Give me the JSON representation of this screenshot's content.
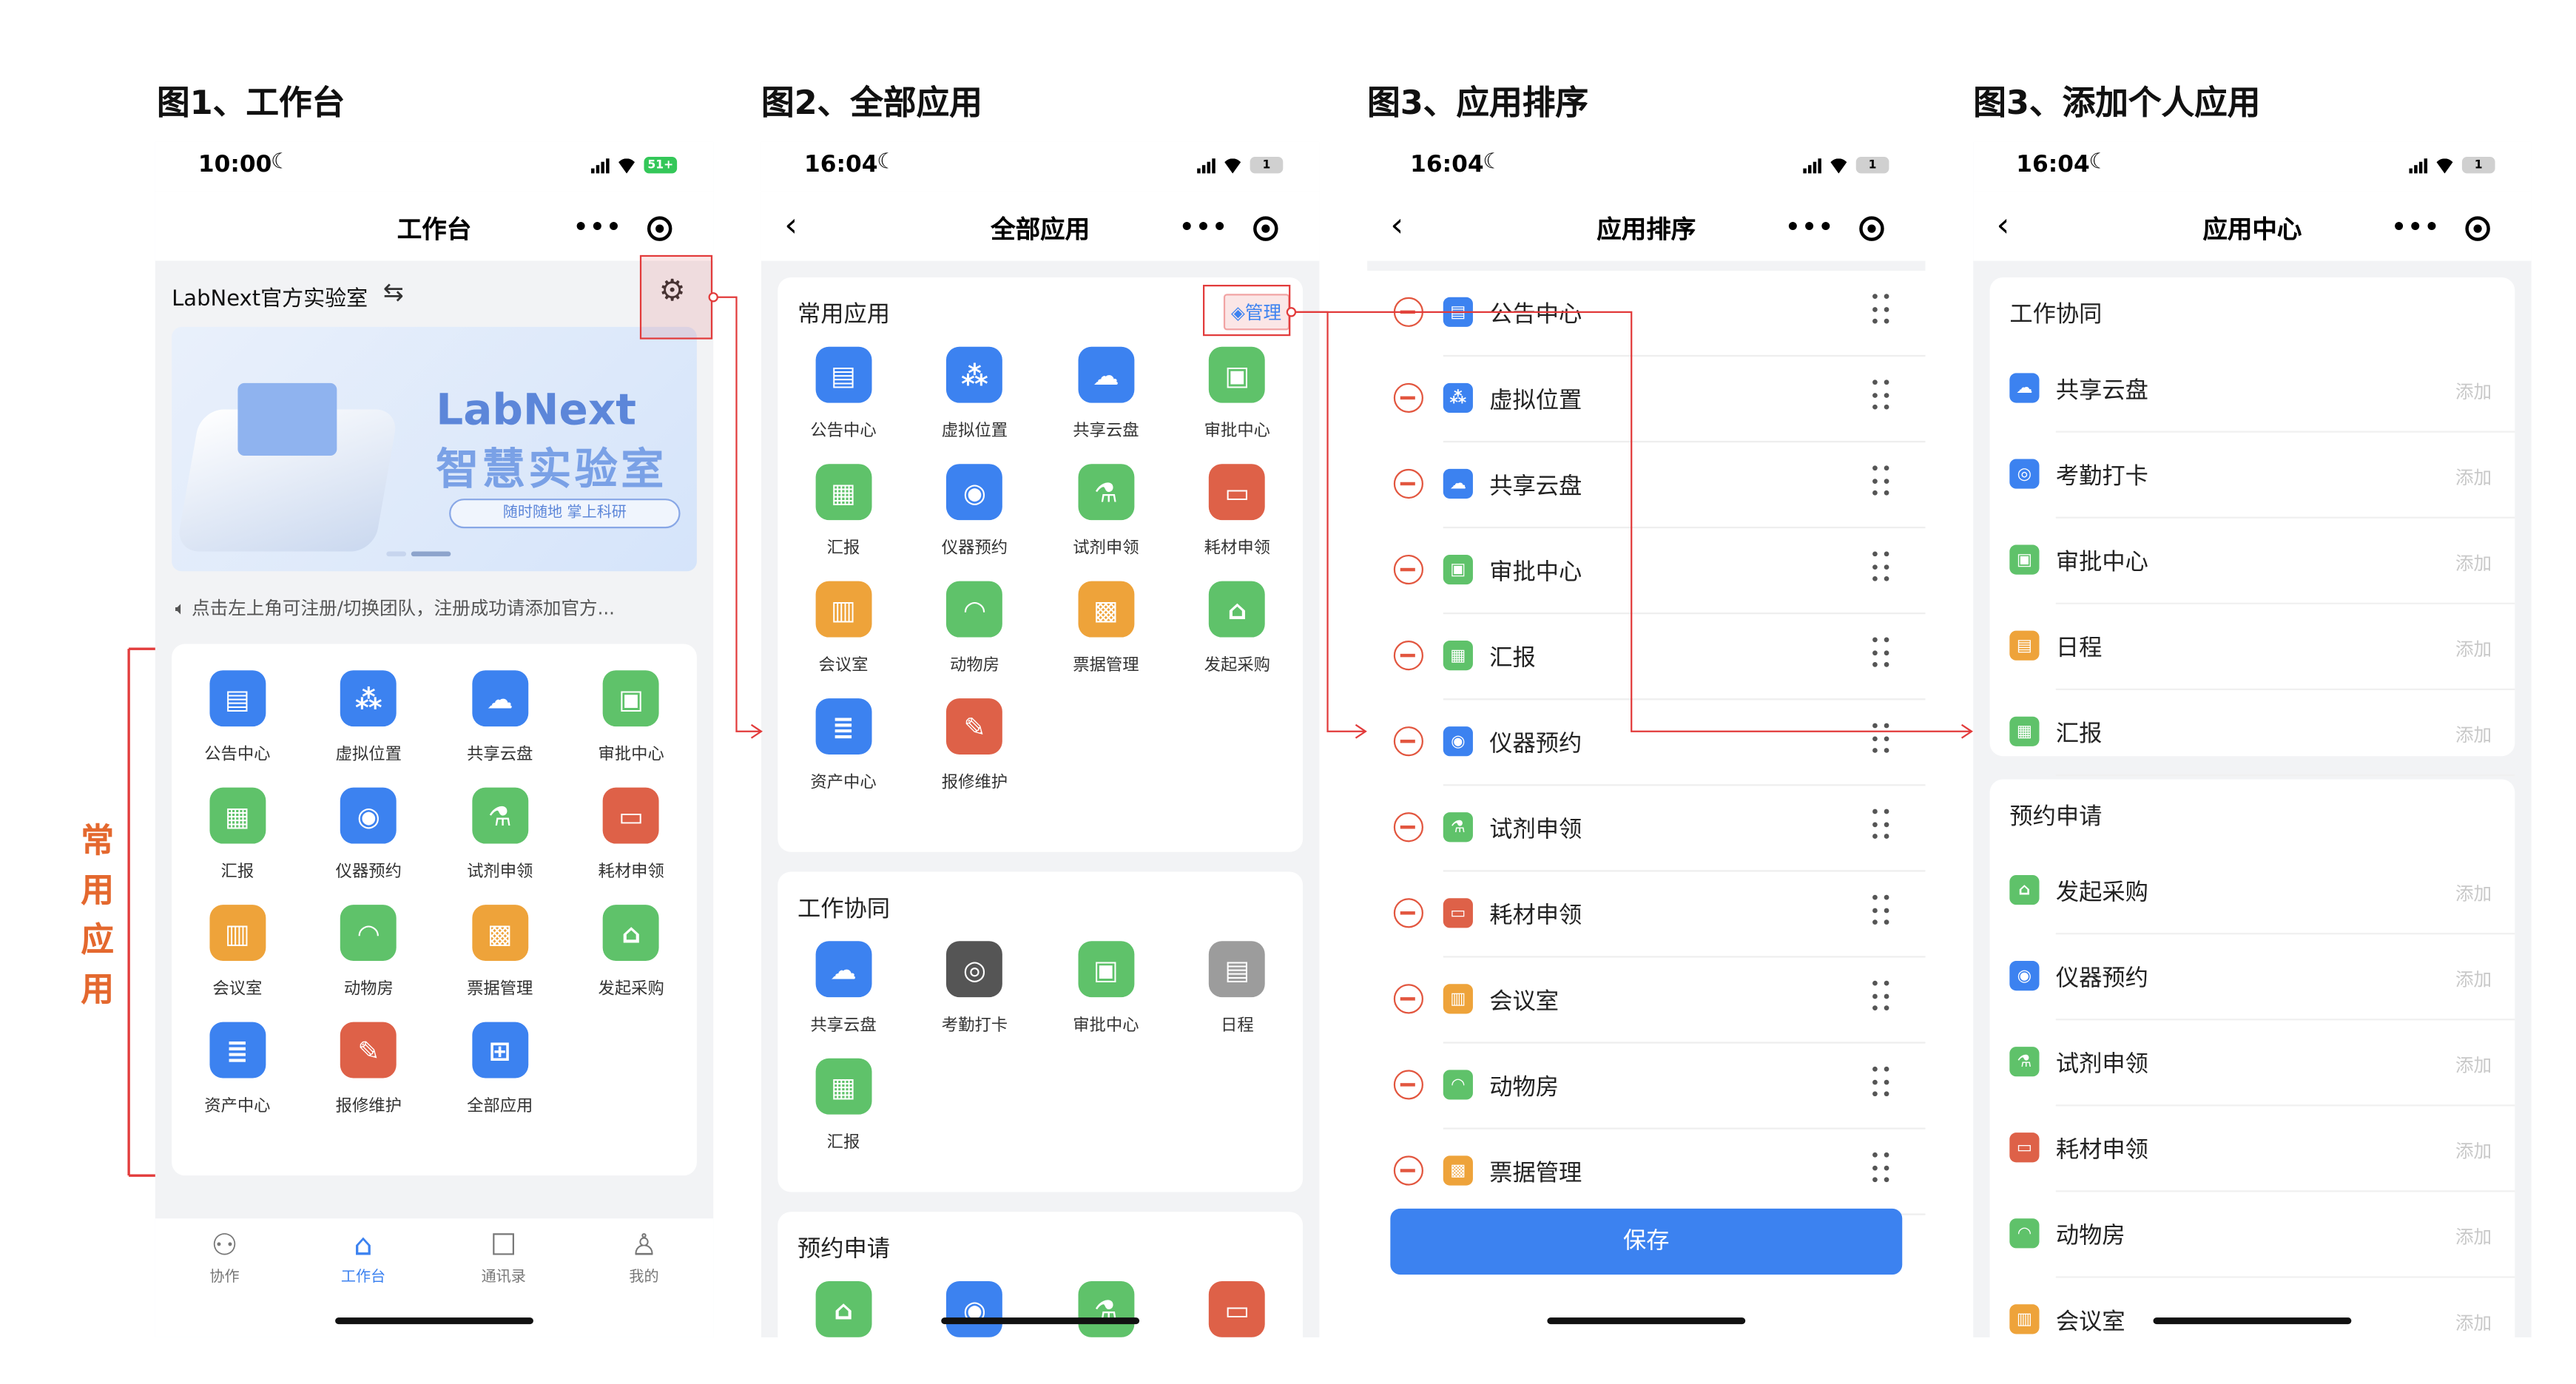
{
  "figures": [
    {
      "title": "图1、工作台",
      "time": "10:00",
      "battery": "51+",
      "nav_title": "工作台",
      "team": "LabNext官方实验室",
      "switch_icon": "swap-icon",
      "settings_icon": "gear-icon",
      "banner": {
        "line1": "LabNext",
        "line2": "智慧实验室",
        "line3": "随时随地  掌上科研"
      },
      "notice": "点击左上角可注册/切换团队，注册成功请添加官方...",
      "side_label": "常用应用",
      "apps": [
        {
          "label": "公告中心",
          "icon": "clipboard-icon",
          "color": "#3c82f0"
        },
        {
          "label": "虚拟位置",
          "icon": "cubes-icon",
          "color": "#3c82f0"
        },
        {
          "label": "共享云盘",
          "icon": "cloud-icon",
          "color": "#3c82f0"
        },
        {
          "label": "审批中心",
          "icon": "approval-icon",
          "color": "#5fc26a"
        },
        {
          "label": "汇报",
          "icon": "calendar-icon",
          "color": "#5fc26a"
        },
        {
          "label": "仪器预约",
          "icon": "instrument-icon",
          "color": "#3c82f0"
        },
        {
          "label": "试剂申领",
          "icon": "flask-icon",
          "color": "#5fc26a"
        },
        {
          "label": "耗材申领",
          "icon": "box-icon",
          "color": "#de6148"
        },
        {
          "label": "会议室",
          "icon": "meeting-icon",
          "color": "#eea33a"
        },
        {
          "label": "动物房",
          "icon": "animal-icon",
          "color": "#5fc26a"
        },
        {
          "label": "票据管理",
          "icon": "ticket-icon",
          "color": "#eea33a"
        },
        {
          "label": "发起采购",
          "icon": "store-icon",
          "color": "#5fc26a"
        },
        {
          "label": "资产中心",
          "icon": "database-icon",
          "color": "#3c82f0"
        },
        {
          "label": "报修维护",
          "icon": "repair-icon",
          "color": "#de6148"
        },
        {
          "label": "全部应用",
          "icon": "grid-plus-icon",
          "color": "#3c82f0"
        }
      ],
      "tabs": [
        {
          "label": "协作",
          "icon": "people-icon"
        },
        {
          "label": "工作台",
          "icon": "desk-icon"
        },
        {
          "label": "通讯录",
          "icon": "contacts-icon"
        },
        {
          "label": "我的",
          "icon": "user-icon"
        }
      ]
    },
    {
      "title": "图2、全部应用",
      "time": "16:04",
      "battery": "1",
      "nav_title": "全部应用",
      "sections": [
        {
          "title": "常用应用",
          "manage": "管理",
          "apps": [
            {
              "label": "公告中心",
              "icon": "clipboard-icon",
              "color": "#3c82f0"
            },
            {
              "label": "虚拟位置",
              "icon": "cubes-icon",
              "color": "#3c82f0"
            },
            {
              "label": "共享云盘",
              "icon": "cloud-icon",
              "color": "#3c82f0"
            },
            {
              "label": "审批中心",
              "icon": "approval-icon",
              "color": "#5fc26a"
            },
            {
              "label": "汇报",
              "icon": "calendar-icon",
              "color": "#5fc26a"
            },
            {
              "label": "仪器预约",
              "icon": "instrument-icon",
              "color": "#3c82f0"
            },
            {
              "label": "试剂申领",
              "icon": "flask-icon",
              "color": "#5fc26a"
            },
            {
              "label": "耗材申领",
              "icon": "box-icon",
              "color": "#de6148"
            },
            {
              "label": "会议室",
              "icon": "meeting-icon",
              "color": "#eea33a"
            },
            {
              "label": "动物房",
              "icon": "animal-icon",
              "color": "#5fc26a"
            },
            {
              "label": "票据管理",
              "icon": "ticket-icon",
              "color": "#eea33a"
            },
            {
              "label": "发起采购",
              "icon": "store-icon",
              "color": "#5fc26a"
            },
            {
              "label": "资产中心",
              "icon": "database-icon",
              "color": "#3c82f0"
            },
            {
              "label": "报修维护",
              "icon": "repair-icon",
              "color": "#de6148"
            }
          ]
        },
        {
          "title": "工作协同",
          "apps": [
            {
              "label": "共享云盘",
              "icon": "cloud-icon",
              "color": "#3c82f0"
            },
            {
              "label": "考勤打卡",
              "icon": "location-icon",
              "color": "#555555"
            },
            {
              "label": "审批中心",
              "icon": "approval-icon",
              "color": "#5fc26a"
            },
            {
              "label": "日程",
              "icon": "schedule-icon",
              "color": "#9c9c9c"
            },
            {
              "label": "汇报",
              "icon": "calendar-icon",
              "color": "#5fc26a"
            }
          ]
        },
        {
          "title": "预约申请",
          "apps": [
            {
              "label": "",
              "icon": "store-icon",
              "color": "#5fc26a"
            },
            {
              "label": "",
              "icon": "instrument-icon",
              "color": "#3c82f0"
            },
            {
              "label": "",
              "icon": "flask-icon",
              "color": "#5fc26a"
            },
            {
              "label": "",
              "icon": "box-icon",
              "color": "#de6148"
            }
          ]
        }
      ]
    },
    {
      "title": "图3、应用排序",
      "time": "16:04",
      "battery": "1",
      "nav_title": "应用排序",
      "save": "保存",
      "rows": [
        {
          "label": "公告中心",
          "icon": "clipboard-icon",
          "color": "#3c82f0"
        },
        {
          "label": "虚拟位置",
          "icon": "cubes-icon",
          "color": "#3c82f0"
        },
        {
          "label": "共享云盘",
          "icon": "cloud-icon",
          "color": "#3c82f0"
        },
        {
          "label": "审批中心",
          "icon": "approval-icon",
          "color": "#5fc26a"
        },
        {
          "label": "汇报",
          "icon": "calendar-icon",
          "color": "#5fc26a"
        },
        {
          "label": "仪器预约",
          "icon": "instrument-icon",
          "color": "#3c82f0"
        },
        {
          "label": "试剂申领",
          "icon": "flask-icon",
          "color": "#5fc26a"
        },
        {
          "label": "耗材申领",
          "icon": "box-icon",
          "color": "#de6148"
        },
        {
          "label": "会议室",
          "icon": "meeting-icon",
          "color": "#eea33a"
        },
        {
          "label": "动物房",
          "icon": "animal-icon",
          "color": "#5fc26a"
        },
        {
          "label": "票据管理",
          "icon": "ticket-icon",
          "color": "#eea33a"
        }
      ]
    },
    {
      "title": "图3、添加个人应用",
      "time": "16:04",
      "battery": "1",
      "nav_title": "应用中心",
      "add": "添加",
      "groups": [
        {
          "title": "工作协同",
          "items": [
            {
              "label": "共享云盘",
              "icon": "cloud-icon",
              "color": "#3c82f0"
            },
            {
              "label": "考勤打卡",
              "icon": "location-icon",
              "color": "#3c82f0"
            },
            {
              "label": "审批中心",
              "icon": "approval-icon",
              "color": "#5fc26a"
            },
            {
              "label": "日程",
              "icon": "schedule-icon",
              "color": "#eea33a"
            },
            {
              "label": "汇报",
              "icon": "calendar-icon",
              "color": "#5fc26a"
            }
          ]
        },
        {
          "title": "预约申请",
          "items": [
            {
              "label": "发起采购",
              "icon": "store-icon",
              "color": "#5fc26a"
            },
            {
              "label": "仪器预约",
              "icon": "instrument-icon",
              "color": "#3c82f0"
            },
            {
              "label": "试剂申领",
              "icon": "flask-icon",
              "color": "#5fc26a"
            },
            {
              "label": "耗材申领",
              "icon": "box-icon",
              "color": "#de6148"
            },
            {
              "label": "动物房",
              "icon": "animal-icon",
              "color": "#5fc26a"
            },
            {
              "label": "会议室",
              "icon": "meeting-icon",
              "color": "#eea33a"
            }
          ]
        }
      ]
    }
  ],
  "accent": "#3c82f0",
  "annotation_color": "#e23b3b"
}
